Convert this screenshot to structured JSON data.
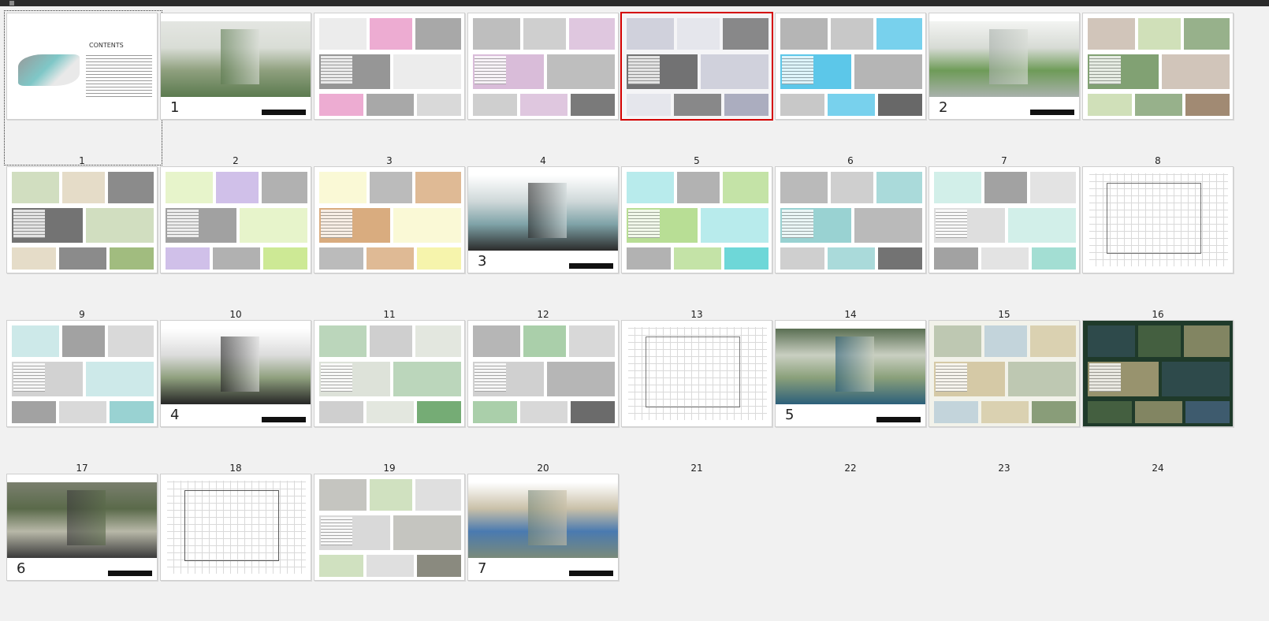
{
  "window": {
    "title": ""
  },
  "pages": [
    {
      "label": "1",
      "kind": "contents",
      "caption": "CONTENTS"
    },
    {
      "label": "2",
      "kind": "cover",
      "number": "1",
      "palette": [
        "#e4e6e2",
        "#5b7a4f",
        "#8fa07e",
        "#d9ddd6"
      ]
    },
    {
      "label": "3",
      "kind": "sheet",
      "palette": [
        "#ffffff",
        "#c9c9c9",
        "#d94fa0",
        "#6b6b6b"
      ]
    },
    {
      "label": "4",
      "kind": "sheet",
      "palette": [
        "#ffffff",
        "#444444",
        "#9a9a9a",
        "#c9a0c9"
      ]
    },
    {
      "label": "5",
      "kind": "sheet",
      "palette": [
        "#f5f5f7",
        "#8d8fa8",
        "#d3d4e0",
        "#3c3c3c"
      ]
    },
    {
      "label": "6",
      "kind": "sheet",
      "palette": [
        "#ffffff",
        "#2a2a2a",
        "#8a8a8a",
        "#1ab0e0"
      ]
    },
    {
      "label": "7",
      "kind": "cover",
      "number": "2",
      "palette": [
        "#f3f4f2",
        "#a9b1ac",
        "#6e9b58",
        "#d7dbd5"
      ]
    },
    {
      "label": "8",
      "kind": "sheet",
      "palette": [
        "#ffffff",
        "#7a5a3a",
        "#9bbe6a",
        "#4e7a3a"
      ]
    },
    {
      "label": "9",
      "kind": "sheet",
      "palette": [
        "#ffffff",
        "#7aa04a",
        "#c8b48a",
        "#3a3a3a"
      ]
    },
    {
      "label": "10",
      "kind": "sheet",
      "palette": [
        "#ffffff",
        "#b9e06a",
        "#9c7ad1",
        "#7a7a7a"
      ]
    },
    {
      "label": "11",
      "kind": "sheet",
      "palette": [
        "#ffffff",
        "#f2ef8a",
        "#6f6f6f",
        "#c98a4a"
      ]
    },
    {
      "label": "12",
      "kind": "cover",
      "number": "3",
      "palette": [
        "#ffffff",
        "#2b2b2b",
        "#7fa3a8",
        "#cfd8d9"
      ]
    },
    {
      "label": "13",
      "kind": "sheet",
      "palette": [
        "#ffffff",
        "#33c6c8",
        "#5b5b5b",
        "#9bd06a"
      ]
    },
    {
      "label": "14",
      "kind": "sheet",
      "palette": [
        "#ffffff",
        "#3a3a3a",
        "#9a9a9a",
        "#6fc0c0"
      ]
    },
    {
      "label": "15",
      "kind": "sheet",
      "palette": [
        "#ffffff",
        "#7ed1c1",
        "#3a3a3a",
        "#d0d0d0"
      ]
    },
    {
      "label": "16",
      "kind": "plan",
      "palette": [
        "#ffffff",
        "#6f6f6f",
        "#c7c7c7",
        "#9a9a9a"
      ]
    },
    {
      "label": "17",
      "kind": "sheet",
      "palette": [
        "#ffffff",
        "#6fc0c0",
        "#3a3a3a",
        "#bfbfbf"
      ]
    },
    {
      "label": "18",
      "kind": "cover",
      "number": "4",
      "palette": [
        "#ffffff",
        "#262626",
        "#8fa07e",
        "#dcdcdc"
      ]
    },
    {
      "label": "19",
      "kind": "sheet",
      "palette": [
        "#ffffff",
        "#3d8a3d",
        "#9a9a9a",
        "#cfd6c9"
      ]
    },
    {
      "label": "20",
      "kind": "sheet",
      "palette": [
        "#ffffff",
        "#2f2f2f",
        "#4a9a4a",
        "#bdbdbd"
      ]
    },
    {
      "label": "21",
      "kind": "plan",
      "palette": [
        "#ffffff",
        "#7a7a7a",
        "#cfcfcf",
        "#4a4a4a"
      ]
    },
    {
      "label": "22",
      "kind": "cover",
      "number": "5",
      "palette": [
        "#5a6f53",
        "#2c5f7a",
        "#8aa07a",
        "#c9cfc1"
      ]
    },
    {
      "label": "23",
      "kind": "sheet",
      "palette": [
        "#f2f2ea",
        "#5e7a4a",
        "#8fb3c9",
        "#c9b98a"
      ]
    },
    {
      "label": "24",
      "kind": "sheet",
      "palette": [
        "#1f3a2a",
        "#4a6a8a",
        "#6e8a5a",
        "#c9b98a"
      ]
    },
    {
      "label": "17",
      "kind": "cover",
      "number": "6",
      "palette": [
        "#7a7f6e",
        "#3a3a3a",
        "#b8b8a8",
        "#5a6a4a"
      ]
    },
    {
      "label": "18",
      "kind": "plan",
      "palette": [
        "#ffffff",
        "#5a5a5a",
        "#c9c9c9",
        "#9bb07a"
      ]
    },
    {
      "label": "19",
      "kind": "sheet",
      "palette": [
        "#ffffff",
        "#5a5a4a",
        "#9bc07a",
        "#c9c9c9"
      ]
    },
    {
      "label": "20",
      "kind": "cover",
      "number": "7",
      "palette": [
        "#ffffff",
        "#7a8a7a",
        "#4a7ab0",
        "#c9c0a8"
      ]
    }
  ],
  "grid_labels_row": [
    "1",
    "2",
    "3",
    "4",
    "5",
    "6",
    "7",
    "8",
    "9",
    "10",
    "11",
    "12",
    "13",
    "14",
    "15",
    "16",
    "17",
    "18",
    "19",
    "20",
    "21",
    "22",
    "23",
    "24"
  ],
  "selected_index": 4,
  "focused_index": 0
}
